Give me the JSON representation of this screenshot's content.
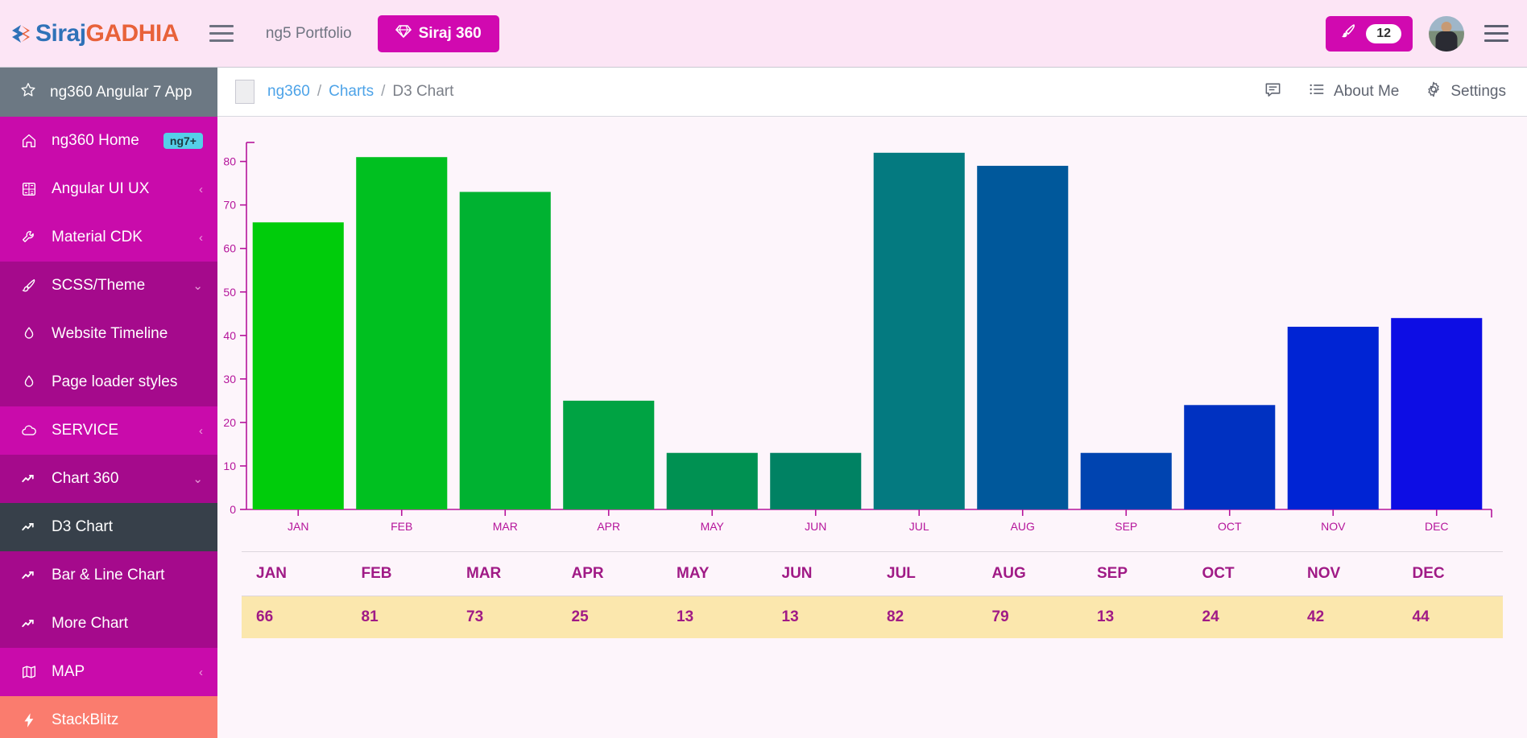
{
  "topbar": {
    "logo_primary": "Siraj",
    "logo_secondary": "GADHIA",
    "logo_icon": "chevron-logo-icon",
    "menu_icon": "hamburger-menu-icon",
    "portfolio_link": "ng5 Portfolio",
    "siraj_button": "Siraj 360",
    "siraj_button_icon": "diamond-icon",
    "brush_icon": "brush-icon",
    "brush_badge": "12",
    "avatar_alt": "user-avatar",
    "right_menu_icon": "hamburger-menu-icon",
    "accent_magenta": "#d109b0",
    "bg_pink": "#fce5f5"
  },
  "sidebar": {
    "header": {
      "label": "ng360 Angular 7 App",
      "icon": "star-icon"
    },
    "items": [
      {
        "label": "ng360 Home",
        "icon": "home-icon",
        "badge": "ng7+",
        "chevron": "",
        "level": "lvl0",
        "active": false
      },
      {
        "label": "Angular UI UX",
        "icon": "grid-icon",
        "badge": "",
        "chevron": "‹",
        "level": "lvl0",
        "active": false
      },
      {
        "label": "Material CDK",
        "icon": "wrench-icon",
        "badge": "",
        "chevron": "‹",
        "level": "lvl0",
        "active": false
      },
      {
        "label": "SCSS/Theme",
        "icon": "brush-icon",
        "badge": "",
        "chevron": "⌄",
        "level": "lvl1",
        "active": false
      },
      {
        "label": "Website Timeline",
        "icon": "drop-icon",
        "badge": "",
        "chevron": "",
        "level": "lvl1",
        "active": false
      },
      {
        "label": "Page loader styles",
        "icon": "drop-icon",
        "badge": "",
        "chevron": "",
        "level": "lvl1",
        "active": false
      },
      {
        "label": "SERVICE",
        "icon": "cloud-icon",
        "badge": "",
        "chevron": "‹",
        "level": "lvl0",
        "active": false
      },
      {
        "label": "Chart 360",
        "icon": "chart-line-icon",
        "badge": "",
        "chevron": "⌄",
        "level": "lvl1",
        "active": false
      },
      {
        "label": "D3 Chart",
        "icon": "chart-line-icon",
        "badge": "",
        "chevron": "",
        "level": "active-item",
        "active": true
      },
      {
        "label": "Bar & Line Chart",
        "icon": "chart-line-icon",
        "badge": "",
        "chevron": "",
        "level": "lvl1",
        "active": false
      },
      {
        "label": "More Chart",
        "icon": "chart-line-icon",
        "badge": "",
        "chevron": "",
        "level": "lvl1",
        "active": false
      },
      {
        "label": "MAP",
        "icon": "map-icon",
        "badge": "",
        "chevron": "‹",
        "level": "lvl0",
        "active": false
      },
      {
        "label": "StackBlitz",
        "icon": "bolt-icon",
        "badge": "",
        "chevron": "",
        "level": "stackblitz",
        "active": false
      }
    ]
  },
  "breadcrumb": {
    "items": [
      "ng360",
      "Charts",
      "D3 Chart"
    ],
    "separator": "/",
    "actions": [
      {
        "label": "",
        "icon": "comment-icon"
      },
      {
        "label": "About Me",
        "icon": "list-icon"
      },
      {
        "label": "Settings",
        "icon": "gear-icon"
      }
    ]
  },
  "chart_data": {
    "type": "bar",
    "title": "",
    "xlabel": "",
    "ylabel": "",
    "categories": [
      "JAN",
      "FEB",
      "MAR",
      "APR",
      "MAY",
      "JUN",
      "JUL",
      "AUG",
      "SEP",
      "OCT",
      "NOV",
      "DEC"
    ],
    "values": [
      66,
      81,
      73,
      25,
      13,
      13,
      82,
      79,
      13,
      24,
      42,
      44
    ],
    "colors": [
      "#00cc0b",
      "#00c020",
      "#00b231",
      "#00a343",
      "#009152",
      "#008263",
      "#047a80",
      "#00589b",
      "#0044b0",
      "#0031c1",
      "#0024d4",
      "#0d0de4"
    ],
    "ylim": [
      0,
      84
    ],
    "yticks": [
      0,
      10,
      20,
      30,
      40,
      50,
      60,
      70,
      80
    ],
    "ytick_labels": [
      "0",
      "10",
      "20",
      "30",
      "40",
      "50",
      "60",
      "70",
      "80"
    ],
    "axis_color": "#b5159b",
    "grid": false,
    "legend": "none",
    "plot_bg": "#fdf5fb"
  },
  "table": {
    "headers": [
      "JAN",
      "FEB",
      "MAR",
      "APR",
      "MAY",
      "JUN",
      "JUL",
      "AUG",
      "SEP",
      "OCT",
      "NOV",
      "DEC"
    ],
    "rows": [
      [
        "66",
        "81",
        "73",
        "25",
        "13",
        "13",
        "82",
        "79",
        "13",
        "24",
        "42",
        "44"
      ]
    ],
    "header_color": "#a01a86",
    "row_bg": "#fbe7ad"
  }
}
